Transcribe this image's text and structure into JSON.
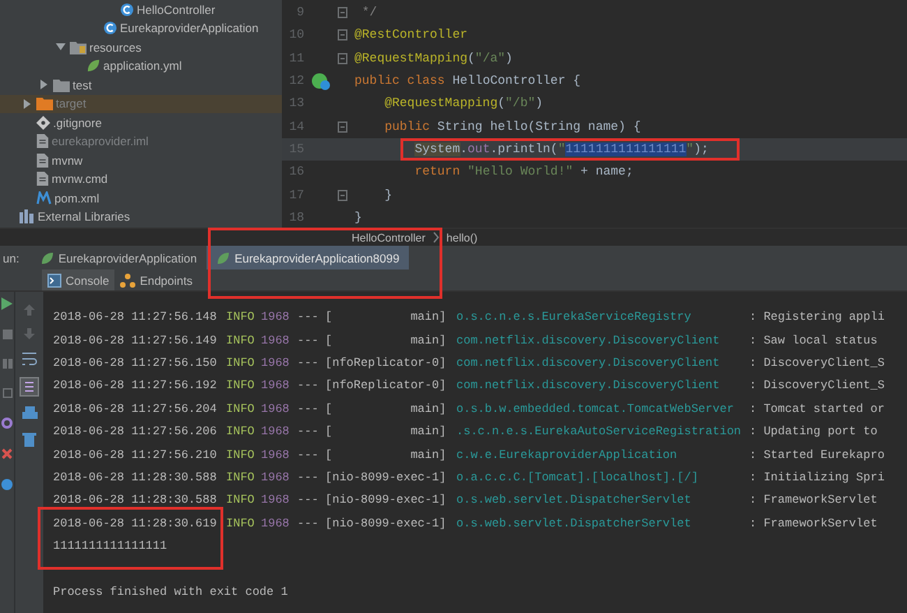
{
  "project_tree": [
    {
      "children": [
        {
          "children": [
            {
              "children": [
                {
                  "children": [
                    {
                      "children": [
                        {
                          "children": [
                            {
                              "label": "HelloController",
                              "kind": "class",
                              "dimmed": false
                            }
                          ]
                        },
                        {
                          "label": "EurekaproviderApplication",
                          "kind": "class",
                          "dimmed": false
                        }
                      ]
                    }
                  ]
                },
                {
                  "label": "resources",
                  "kind": "resources-folder",
                  "expanded": true,
                  "dimmed": false,
                  "children": [
                    {
                      "label": "application.yml",
                      "kind": "yml",
                      "dimmed": false
                    }
                  ]
                }
              ]
            },
            {
              "label": "test",
              "kind": "folder",
              "expanded": false,
              "dimmed": false
            }
          ]
        },
        {
          "label": "target",
          "kind": "excluded-folder",
          "expanded": false,
          "dimmed": true
        },
        {
          "label": ".gitignore",
          "kind": "git",
          "dimmed": false
        },
        {
          "label": "eurekaprovider.iml",
          "kind": "file",
          "dimmed": true
        },
        {
          "label": "mvnw",
          "kind": "file",
          "dimmed": false
        },
        {
          "label": "mvnw.cmd",
          "kind": "file",
          "dimmed": false
        },
        {
          "label": "pom.xml",
          "kind": "maven",
          "dimmed": false
        }
      ]
    },
    {
      "label": "External Libraries",
      "kind": "libraries",
      "dimmed": false
    }
  ],
  "editor": {
    "lines": [
      {
        "number": "9",
        "kind": "fold",
        "current": false,
        "boxed": false,
        "tokens": [
          {
            "t": " */",
            "kind": "comment"
          }
        ]
      },
      {
        "number": "10",
        "kind": "fold",
        "current": false,
        "boxed": false,
        "tokens": [
          {
            "t": "@RestController",
            "kind": "ann"
          }
        ]
      },
      {
        "number": "11",
        "kind": "fold",
        "current": false,
        "boxed": false,
        "tokens": [
          {
            "t": "@RequestMapping",
            "kind": "ann"
          },
          {
            "t": "(",
            "kind": "plain"
          },
          {
            "t": "\"/a\"",
            "kind": "str"
          },
          {
            "t": ")",
            "kind": "plain"
          }
        ]
      },
      {
        "number": "12",
        "kind": "bean",
        "current": false,
        "boxed": false,
        "tokens": [
          {
            "t": "public class ",
            "kind": "kw"
          },
          {
            "t": "HelloController {",
            "kind": "plain"
          }
        ]
      },
      {
        "number": "13",
        "kind": "plain",
        "current": false,
        "boxed": false,
        "tokens": [
          {
            "t": "    @RequestMapping",
            "kind": "ann"
          },
          {
            "t": "(",
            "kind": "plain"
          },
          {
            "t": "\"/b\"",
            "kind": "str"
          },
          {
            "t": ")",
            "kind": "plain"
          }
        ]
      },
      {
        "number": "14",
        "kind": "fold",
        "current": false,
        "boxed": false,
        "tokens": [
          {
            "t": "    public ",
            "kind": "kw"
          },
          {
            "t": "String hello(String name) {",
            "kind": "plain"
          }
        ]
      },
      {
        "number": "15",
        "kind": "plain",
        "current": true,
        "boxed": true,
        "tokens": [
          {
            "t": "        System",
            "kind": "hl"
          },
          {
            "t": ".",
            "kind": "plain"
          },
          {
            "t": "out",
            "kind": "field"
          },
          {
            "t": ".println(",
            "kind": "plain"
          },
          {
            "t": "\"",
            "kind": "str"
          },
          {
            "t": "1111111111111111",
            "kind": "sel"
          },
          {
            "t": "\"",
            "kind": "str"
          },
          {
            "t": ");",
            "kind": "plain"
          }
        ]
      },
      {
        "number": "16",
        "kind": "plain",
        "current": false,
        "boxed": false,
        "tokens": [
          {
            "t": "        return ",
            "kind": "kw"
          },
          {
            "t": "\"Hello World!\"",
            "kind": "str"
          },
          {
            "t": " + name;",
            "kind": "plain"
          }
        ]
      },
      {
        "number": "17",
        "kind": "fold",
        "current": false,
        "boxed": false,
        "tokens": [
          {
            "t": "    }",
            "kind": "plain"
          }
        ]
      },
      {
        "number": "18",
        "kind": "plain",
        "current": false,
        "boxed": false,
        "tokens": [
          {
            "t": "}",
            "kind": "plain"
          }
        ]
      }
    ]
  },
  "breadcrumbs": [
    "HelloController",
    "hello()"
  ],
  "run_panel": {
    "label": "un:",
    "tabs": [
      {
        "label": "EurekaproviderApplication",
        "selected": false,
        "boxed": false
      },
      {
        "label": "EurekaproviderApplication8099",
        "selected": true,
        "boxed": true
      }
    ],
    "subtabs": [
      {
        "label": "Console",
        "kind": "console",
        "selected": true
      },
      {
        "label": "Endpoints",
        "kind": "endpoints",
        "selected": false
      }
    ]
  },
  "console": [
    {
      "kind": "log",
      "time": "2018-06-28 11:27:56.148",
      "level": "INFO",
      "pid": "1968",
      "sep": "---",
      "thread": "[           main]",
      "logger": "o.s.c.n.e.s.EurekaServiceRegistry",
      "message": ": Registering appli"
    },
    {
      "kind": "log",
      "time": "2018-06-28 11:27:56.149",
      "level": "INFO",
      "pid": "1968",
      "sep": "---",
      "thread": "[           main]",
      "logger": "com.netflix.discovery.DiscoveryClient",
      "message": ": Saw local status"
    },
    {
      "kind": "log",
      "time": "2018-06-28 11:27:56.150",
      "level": "INFO",
      "pid": "1968",
      "sep": "---",
      "thread": "[nfoReplicator-0]",
      "logger": "com.netflix.discovery.DiscoveryClient",
      "message": ": DiscoveryClient_S"
    },
    {
      "kind": "log",
      "time": "2018-06-28 11:27:56.192",
      "level": "INFO",
      "pid": "1968",
      "sep": "---",
      "thread": "[nfoReplicator-0]",
      "logger": "com.netflix.discovery.DiscoveryClient",
      "message": ": DiscoveryClient_S"
    },
    {
      "kind": "log",
      "time": "2018-06-28 11:27:56.204",
      "level": "INFO",
      "pid": "1968",
      "sep": "---",
      "thread": "[           main]",
      "logger": "o.s.b.w.embedded.tomcat.TomcatWebServer",
      "message": ": Tomcat started or"
    },
    {
      "kind": "log",
      "time": "2018-06-28 11:27:56.206",
      "level": "INFO",
      "pid": "1968",
      "sep": "---",
      "thread": "[           main]",
      "logger": ".s.c.n.e.s.EurekaAutoServiceRegistration",
      "message": ": Updating port to"
    },
    {
      "kind": "log",
      "time": "2018-06-28 11:27:56.210",
      "level": "INFO",
      "pid": "1968",
      "sep": "---",
      "thread": "[           main]",
      "logger": "c.w.e.EurekaproviderApplication",
      "message": ": Started Eurekapro"
    },
    {
      "kind": "log",
      "time": "2018-06-28 11:28:30.588",
      "level": "INFO",
      "pid": "1968",
      "sep": "---",
      "thread": "[nio-8099-exec-1]",
      "logger": "o.a.c.c.C.[Tomcat].[localhost].[/]",
      "message": ": Initializing Spri"
    },
    {
      "kind": "log",
      "time": "2018-06-28 11:28:30.588",
      "level": "INFO",
      "pid": "1968",
      "sep": "---",
      "thread": "[nio-8099-exec-1]",
      "logger": "o.s.web.servlet.DispatcherServlet",
      "message": ": FrameworkServlet"
    },
    {
      "kind": "log",
      "time": "2018-06-28 11:28:30.619",
      "level": "INFO",
      "pid": "1968",
      "sep": "---",
      "thread": "[nio-8099-exec-1]",
      "logger": "o.s.web.servlet.DispatcherServlet",
      "message": ": FrameworkServlet"
    },
    {
      "kind": "boxed-text",
      "text": "1111111111111111"
    },
    {
      "kind": "gap"
    },
    {
      "kind": "text",
      "text": "Process finished with exit code 1"
    }
  ]
}
